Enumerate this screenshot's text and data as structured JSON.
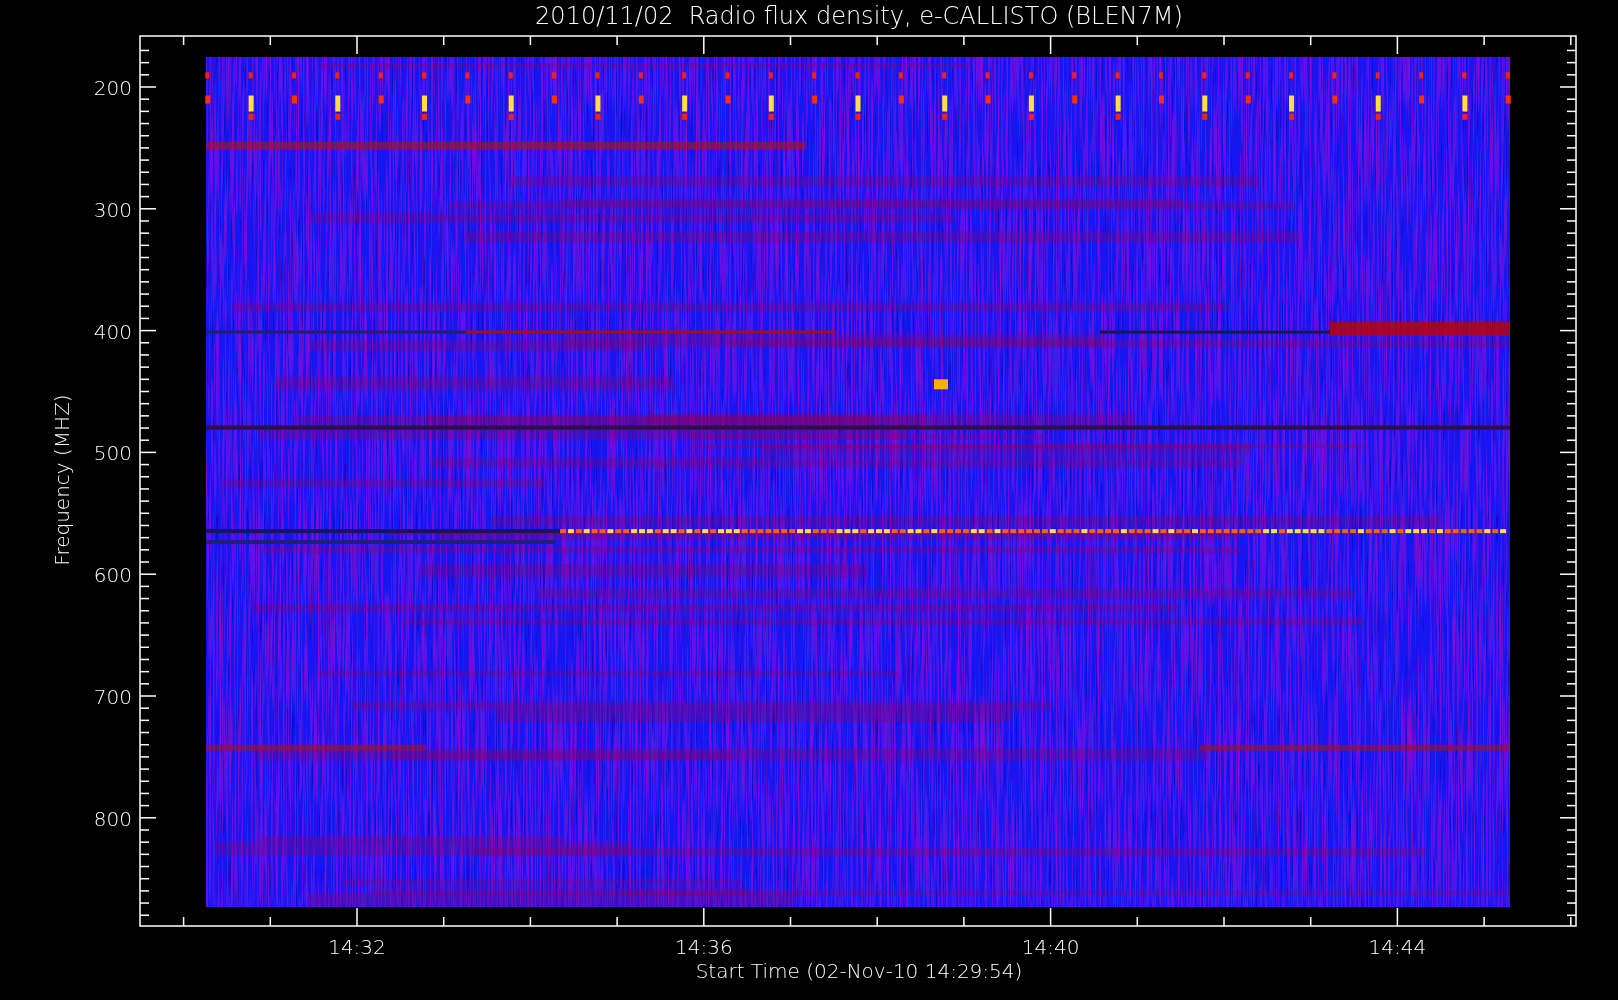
{
  "title": "2010/11/02  Radio flux density, e-CALLISTO (BLEN7M)",
  "y_axis": {
    "label": "Frequency (MHZ)",
    "ticks": [
      "200",
      "300",
      "400",
      "500",
      "600",
      "700",
      "800"
    ]
  },
  "x_axis": {
    "label": "Start Time (02-Nov-10 14:29:54)",
    "ticks": [
      "14:32",
      "14:36",
      "14:40",
      "14:44"
    ]
  }
}
